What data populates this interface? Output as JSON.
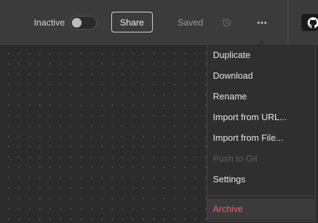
{
  "topbar": {
    "status_label": "Inactive",
    "share_label": "Share",
    "saved_label": "Saved",
    "icons": [
      "history-icon",
      "more-horizontal-icon",
      "github-icon"
    ]
  },
  "menu": {
    "items": [
      {
        "label": "Duplicate",
        "disabled": false
      },
      {
        "label": "Download",
        "disabled": false
      },
      {
        "label": "Rename",
        "disabled": false
      },
      {
        "label": "Import from URL...",
        "disabled": false
      },
      {
        "label": "Import from File...",
        "disabled": false
      },
      {
        "label": "Push to Git",
        "disabled": true
      },
      {
        "label": "Settings",
        "disabled": false
      }
    ],
    "archive_label": "Archive"
  },
  "colors": {
    "topbar_bg": "#3b3b3b",
    "canvas_bg": "#2b2b2b",
    "menu_bg": "#2f2f2f",
    "danger": "#f0616d"
  }
}
